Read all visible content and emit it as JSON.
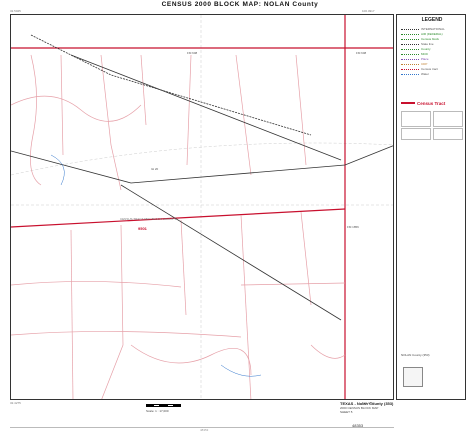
{
  "title": "CENSUS 2000 BLOCK MAP: NOLAN County",
  "legend": {
    "title": "LEGEND",
    "entries": [
      "INTERNATIONAL",
      "AIR (FEDERAL)",
      "Census block",
      "State line",
      "County",
      "MCD",
      "Place",
      "CDP",
      "Census tract",
      "Water"
    ],
    "census_tract_label": "Census Tract"
  },
  "map": {
    "block_number": "9501",
    "area_label": "CENSUS TRACT 9501 BLOCK GROUP 1",
    "road_labels": [
      "FM 608",
      "FM 608",
      "IH 20",
      "FM 1856"
    ],
    "coord_labels": [
      "32.5025",
      "32.4275",
      "100.4917",
      "100.4167"
    ],
    "scale_note": "Scale: 1 : 17,000",
    "sheet_code": "48353",
    "county_code": "NOLAN County (353)"
  },
  "bottom": {
    "title": "TEXAS - Nolan County (353)",
    "subtitle": "2000 CENSUS BLOCK MAP",
    "sheet": "SHEET 5",
    "sheet_id": "48353"
  },
  "colors": {
    "boundary": "#c8102e",
    "road": "#333333",
    "stream": "#3377cc",
    "pink": "#e6a0a8"
  }
}
